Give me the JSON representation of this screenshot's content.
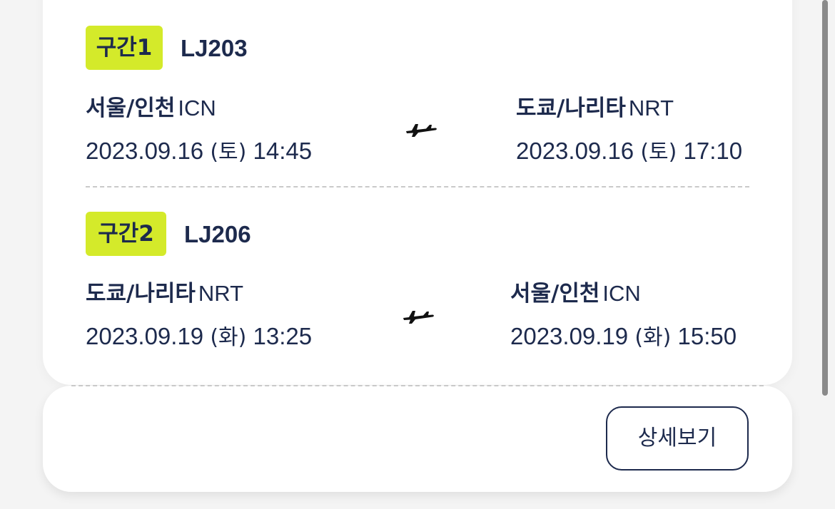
{
  "segments": [
    {
      "badge": "구간1",
      "flight_no": "LJ203",
      "from": {
        "city": "서울/인천",
        "code": "ICN",
        "date": "2023.09.16",
        "dow": "(토)",
        "time": "14:45"
      },
      "to": {
        "city": "도쿄/나리타",
        "code": "NRT",
        "date": "2023.09.16",
        "dow": "(토)",
        "time": "17:10"
      }
    },
    {
      "badge": "구간2",
      "flight_no": "LJ206",
      "from": {
        "city": "도쿄/나리타",
        "code": "NRT",
        "date": "2023.09.19",
        "dow": "(화)",
        "time": "13:25"
      },
      "to": {
        "city": "서울/인천",
        "code": "ICN",
        "date": "2023.09.19",
        "dow": "(화)",
        "time": "15:50"
      }
    }
  ],
  "actions": {
    "details_label": "상세보기"
  },
  "icons": {
    "plane": "airplane-icon"
  },
  "colors": {
    "badge": "#d4ea2a",
    "text": "#1d2a4d",
    "card": "#ffffff",
    "background": "#f4f4f4"
  }
}
